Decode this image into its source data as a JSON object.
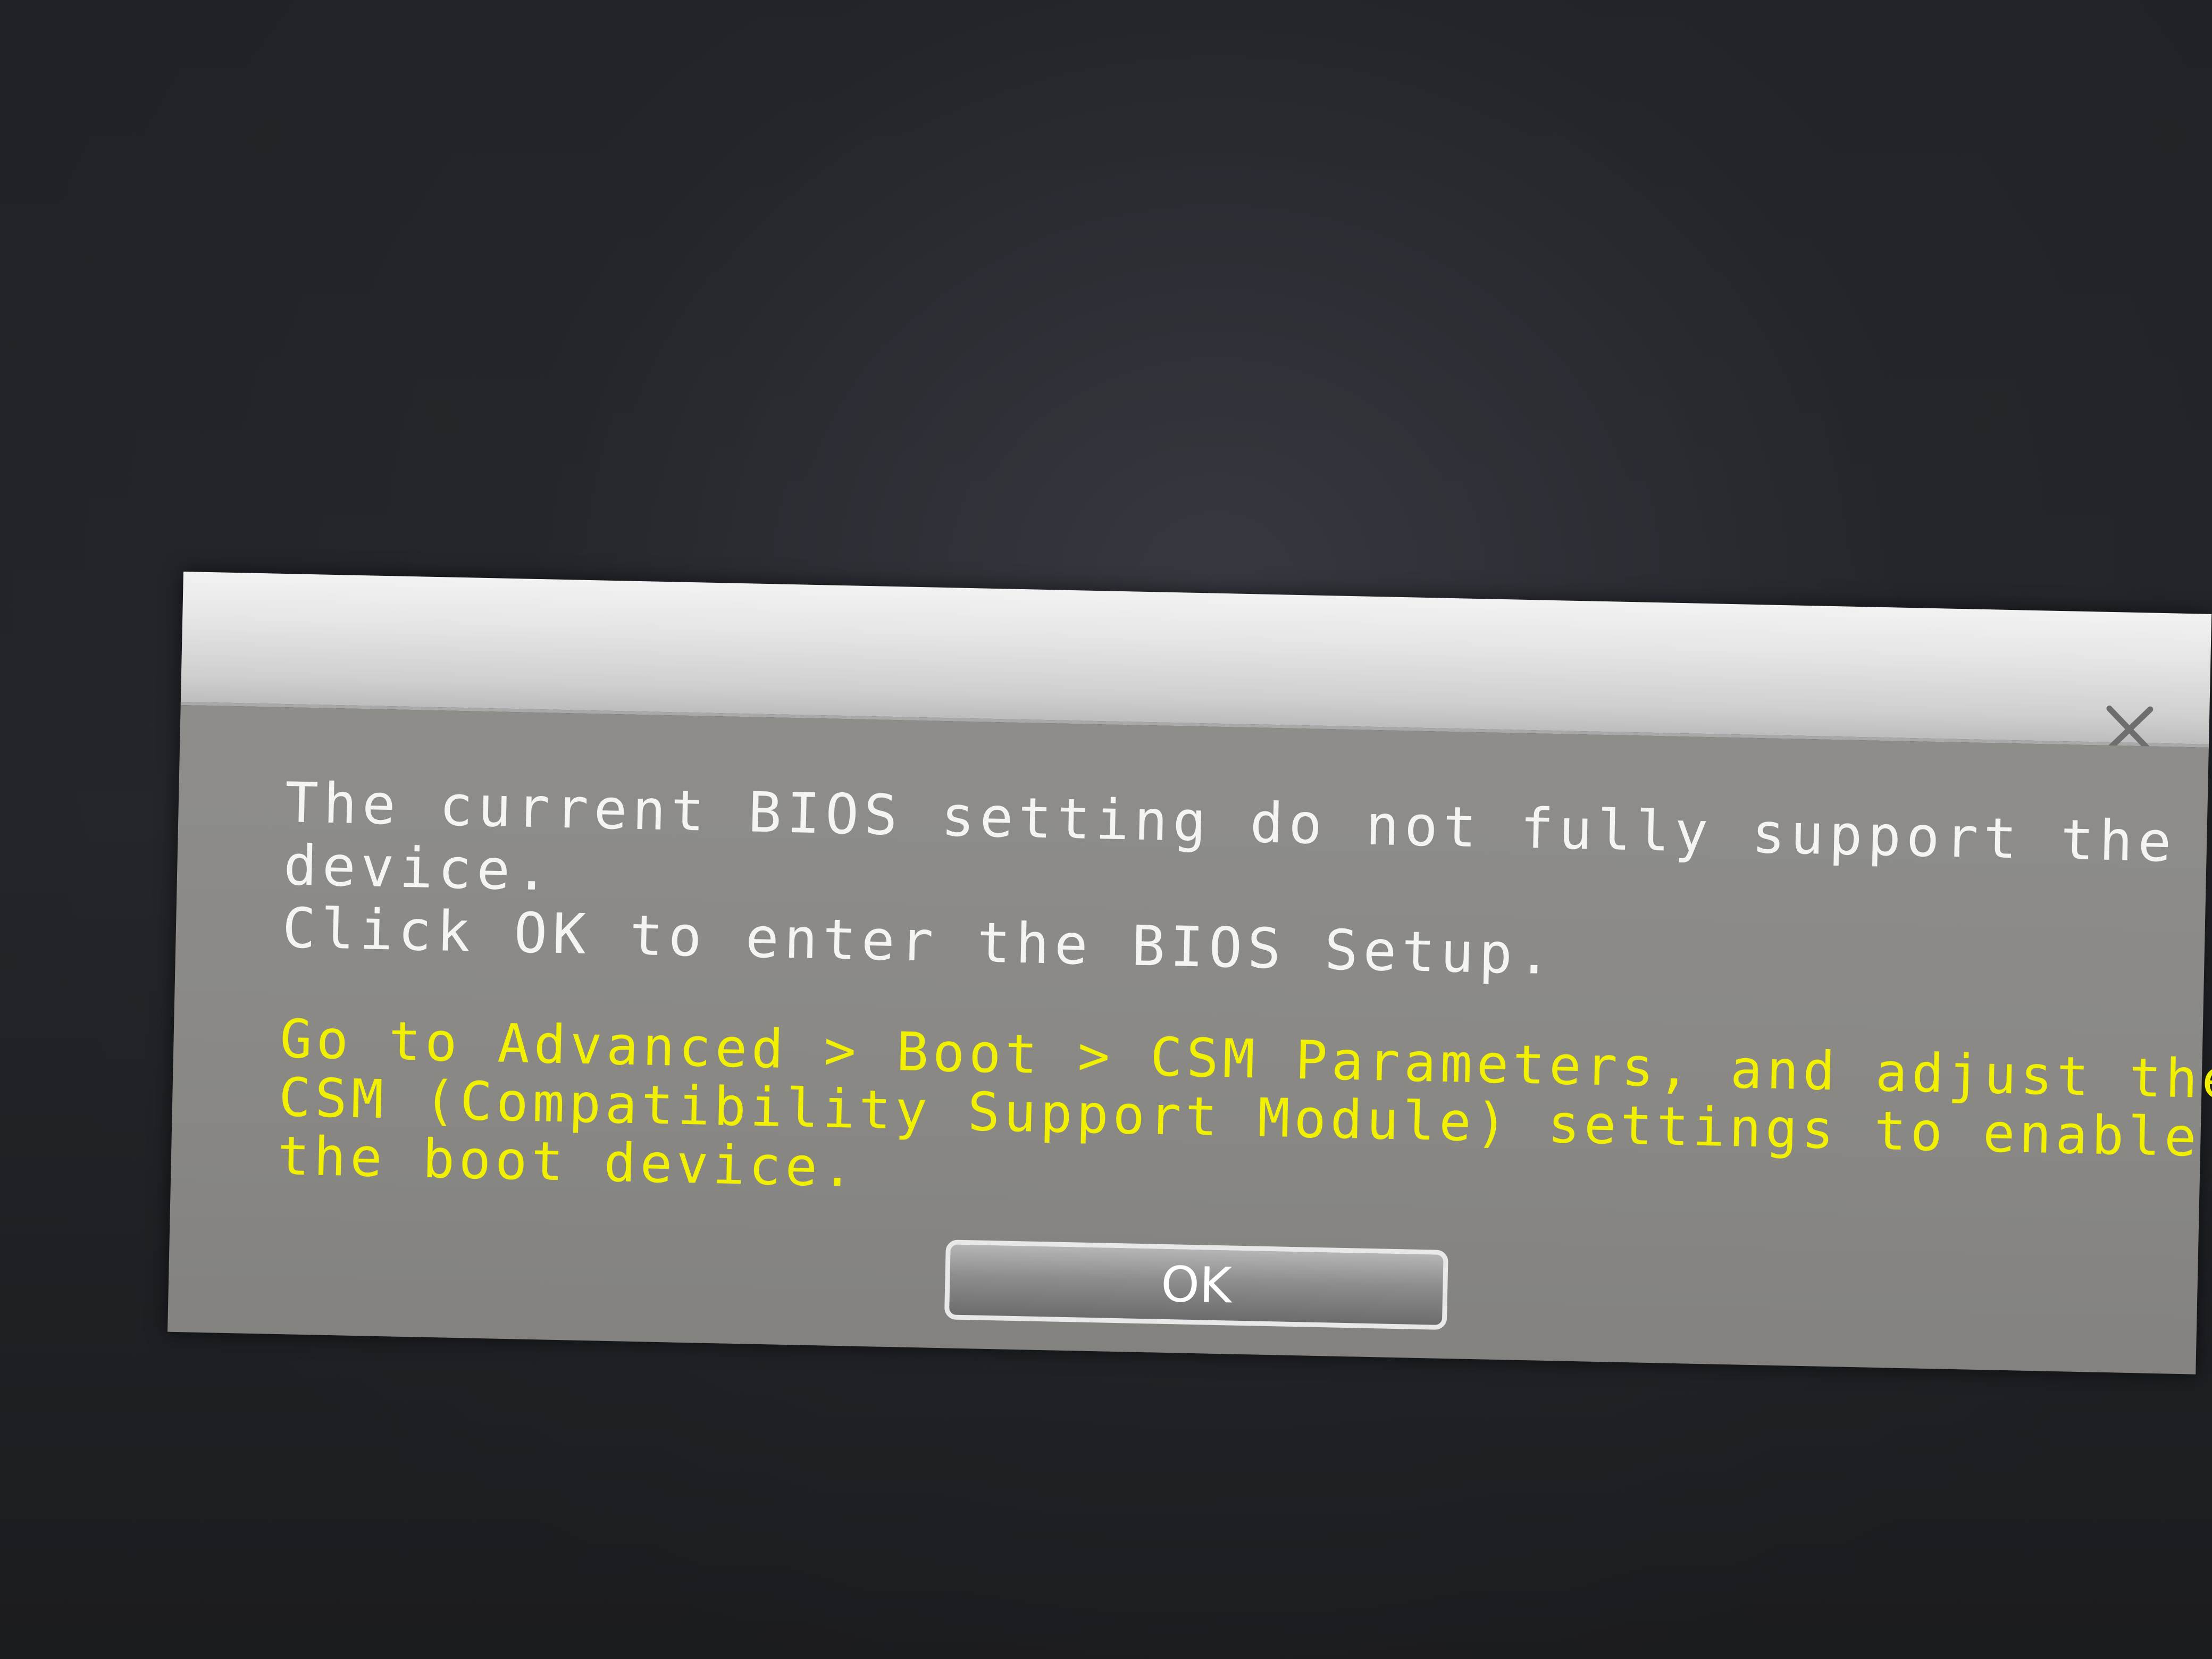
{
  "dialog": {
    "close_icon": "close-icon",
    "message_lines": [
      "The current BIOS setting do not fully support the boot",
      "device.",
      "Click OK to enter the BIOS Setup."
    ],
    "hint_lines": [
      "Go to Advanced > Boot > CSM Parameters, and adjust the",
      "CSM (Compatibility Support Module) settings to enable",
      "the boot device."
    ],
    "ok_label": "OK"
  },
  "colors": {
    "message_text": "#f4f4f2",
    "hint_text": "#f1f000",
    "dialog_body": "#8a8985",
    "titlebar": "#e6e6e6",
    "background": "#1c1e22"
  }
}
